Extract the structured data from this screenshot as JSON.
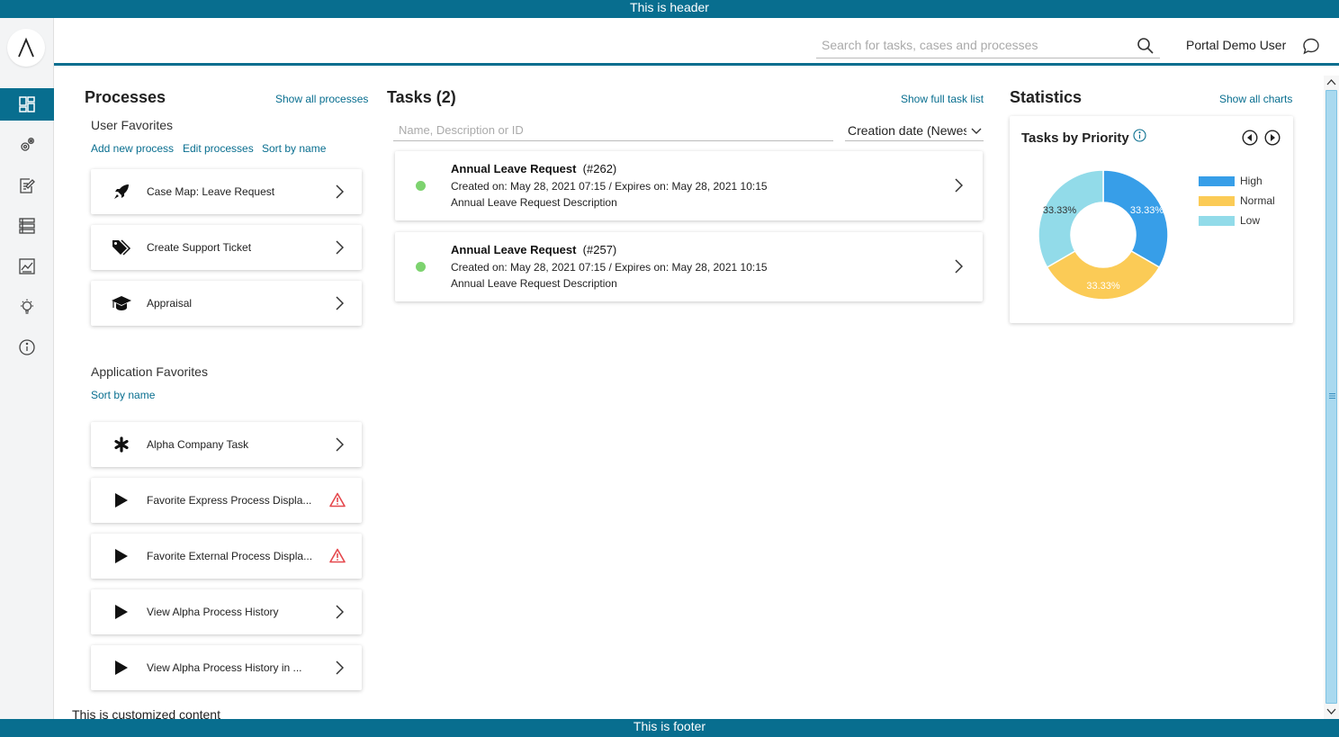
{
  "banner": {
    "header": "This is header",
    "footer": "This is footer"
  },
  "topbar": {
    "search_placeholder": "Search for tasks, cases and processes",
    "user_name": "Portal Demo User"
  },
  "nav": {
    "items": [
      {
        "name": "dashboard-icon",
        "active": true
      },
      {
        "name": "processes-gear-icon",
        "active": false
      },
      {
        "name": "tasks-edit-icon",
        "active": false
      },
      {
        "name": "cases-list-icon",
        "active": false
      },
      {
        "name": "statistics-chart-icon",
        "active": false
      },
      {
        "name": "ideas-bulb-icon",
        "active": false
      },
      {
        "name": "info-icon",
        "active": false
      }
    ]
  },
  "processes": {
    "title": "Processes",
    "show_all": "Show all processes",
    "user_favorites_title": "User Favorites",
    "add_new": "Add new process",
    "edit": "Edit processes",
    "sort_user": "Sort by name",
    "user_items": [
      {
        "label": "Case Map: Leave Request",
        "icon": "rocket-icon"
      },
      {
        "label": "Create Support Ticket",
        "icon": "tag-icon"
      },
      {
        "label": "Appraisal",
        "icon": "graduation-cap-icon"
      }
    ],
    "app_favorites_title": "Application Favorites",
    "sort_app": "Sort by name",
    "app_items": [
      {
        "label": "Alpha Company Task",
        "icon": "asterisk-icon",
        "warning": false
      },
      {
        "label": "Favorite Express Process Displa...",
        "icon": "play-icon",
        "warning": true
      },
      {
        "label": "Favorite External Process Displa...",
        "icon": "play-icon",
        "warning": true
      },
      {
        "label": "View Alpha Process History",
        "icon": "play-icon",
        "warning": false
      },
      {
        "label": "View Alpha Process History in ...",
        "icon": "play-icon",
        "warning": false
      }
    ]
  },
  "tasks": {
    "title": "Tasks (2)",
    "show_full": "Show full task list",
    "filter_placeholder": "Name, Description or ID",
    "sort_value": "Creation date (Newest first)",
    "items": [
      {
        "name": "Annual Leave Request",
        "id": "(#262)",
        "dates": "Created on: May 28, 2021 07:15 / Expires on: May 28, 2021 10:15",
        "description": "Annual Leave Request Description",
        "status_color": "#7dd36f"
      },
      {
        "name": "Annual Leave Request",
        "id": "(#257)",
        "dates": "Created on: May 28, 2021 07:15 / Expires on: May 28, 2021 10:15",
        "description": "Annual Leave Request Description",
        "status_color": "#7dd36f"
      }
    ]
  },
  "statistics": {
    "title": "Statistics",
    "show_all": "Show all charts"
  },
  "chart_data": {
    "type": "pie",
    "title": "Tasks by Priority",
    "categories": [
      "High",
      "Normal",
      "Low"
    ],
    "values": [
      33.33,
      33.33,
      33.33
    ],
    "labels": [
      "33.33%",
      "33.33%",
      "33.33%"
    ],
    "colors": [
      "#379ee8",
      "#fbcb56",
      "#92dbe9"
    ],
    "donut": true,
    "legend": "right"
  },
  "custom_content": "This is customized content"
}
